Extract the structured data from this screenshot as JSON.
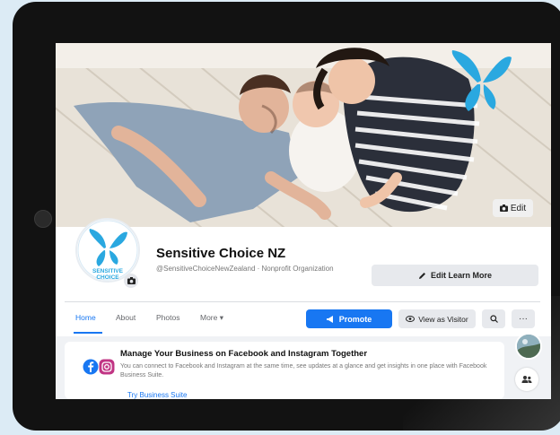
{
  "cover": {
    "edit_label": "Edit"
  },
  "profile": {
    "logo_text_line1": "SENSITIVE",
    "logo_text_line2": "CHOICE",
    "name": "Sensitive Choice NZ",
    "handle": "@SensitiveChoiceNewZealand · Nonprofit Organization",
    "edit_learn_more": "Edit Learn More"
  },
  "tabs": [
    {
      "label": "Home",
      "active": true
    },
    {
      "label": "About",
      "active": false
    },
    {
      "label": "Photos",
      "active": false
    },
    {
      "label": "More ▾",
      "active": false
    }
  ],
  "actions": {
    "promote": "Promote",
    "view_as_visitor": "View as Visitor",
    "more": "···"
  },
  "business_card": {
    "title": "Manage Your Business on Facebook and Instagram Together",
    "description": "You can connect to Facebook and Instagram at the same time, see updates at a glance and get insights in one place with Facebook Business Suite.",
    "link": "Try Business Suite"
  },
  "colors": {
    "facebook_blue": "#1877f2",
    "brand_butterfly": "#2aa8e0",
    "tablet_bezel": "#121212"
  }
}
